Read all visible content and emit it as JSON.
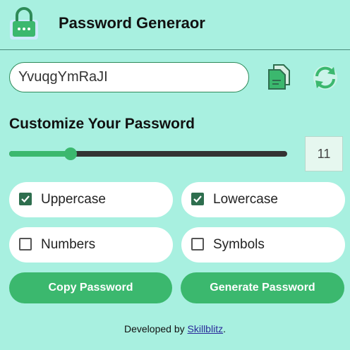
{
  "header": {
    "title": "Password Generaor",
    "logo_icon": "lock-icon"
  },
  "password": {
    "value": "YvuqgYmRaJI",
    "copy_icon": "copy-icon",
    "refresh_icon": "refresh-icon"
  },
  "customize": {
    "title": "Customize Your Password",
    "length_value": "11",
    "slider_fraction": 0.22
  },
  "options": {
    "uppercase": {
      "label": "Uppercase",
      "checked": true
    },
    "lowercase": {
      "label": "Lowercase",
      "checked": true
    },
    "numbers": {
      "label": "Numbers",
      "checked": false
    },
    "symbols": {
      "label": "Symbols",
      "checked": false
    }
  },
  "buttons": {
    "copy": "Copy Password",
    "generate": "Generate Password"
  },
  "footer": {
    "prefix": "Developed by ",
    "link": "Skillblitz",
    "suffix": "."
  },
  "colors": {
    "background": "#a8f0e0",
    "accent": "#3bb86e",
    "checkbox": "#2e6e4e"
  }
}
